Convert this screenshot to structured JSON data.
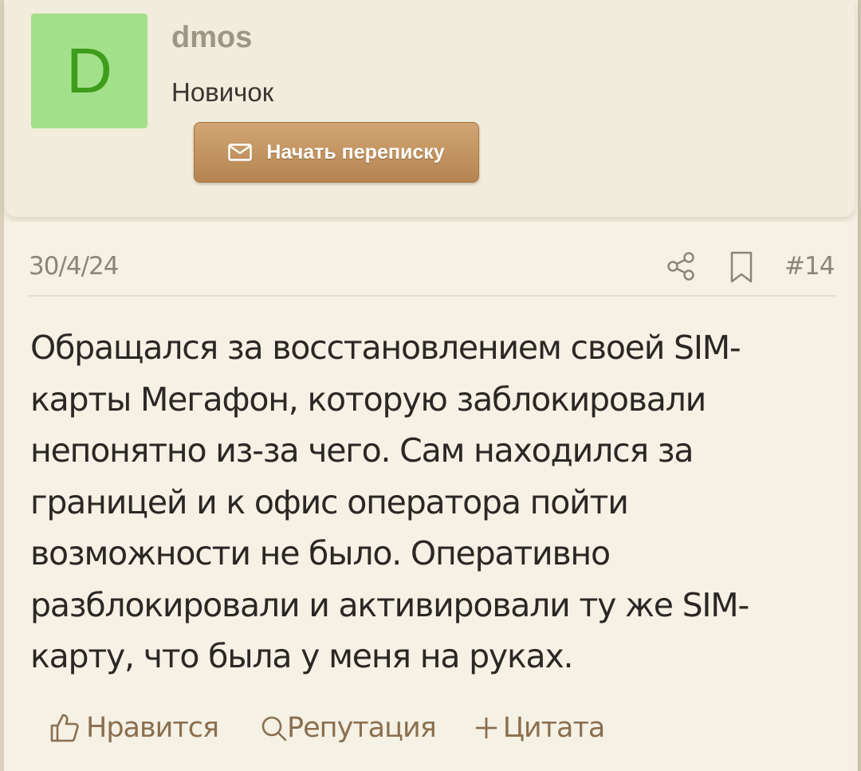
{
  "author": {
    "avatar_letter": "D",
    "avatar_color": "#a3e08a",
    "avatar_letter_color": "#3e9d1b",
    "username": "dmos",
    "title": "Новичок",
    "start_conversation_label": "Начать переписку",
    "start_conversation_icon": "envelope-icon"
  },
  "post": {
    "date": "30/4/24",
    "number": "#14",
    "share_icon": "share-icon",
    "bookmark_icon": "bookmark-icon",
    "body": "Обращался за восстановлением своей SIM-\nкарты Мегафон, которую заблокировали\nнепонятно из-за чего. Сам находился за\nграницей и к офис оператора пойти\nвозможности не было. Оперативно\nразблокировали и активировали ту же SIM-\nкарту, что была у меня на руках."
  },
  "actions": {
    "like_label": "Нравится",
    "like_icon": "thumbs-up-icon",
    "reputation_label": "Репутация",
    "reputation_icon": "search-icon",
    "quote_label": "Цитата",
    "quote_icon": "plus-icon"
  },
  "colors": {
    "page_background": "#f3efe2",
    "button_gradient_top": "#d1a672",
    "button_gradient_bottom": "#b58452",
    "action_link": "#8a6f4f",
    "meta_text": "#8b8577"
  }
}
